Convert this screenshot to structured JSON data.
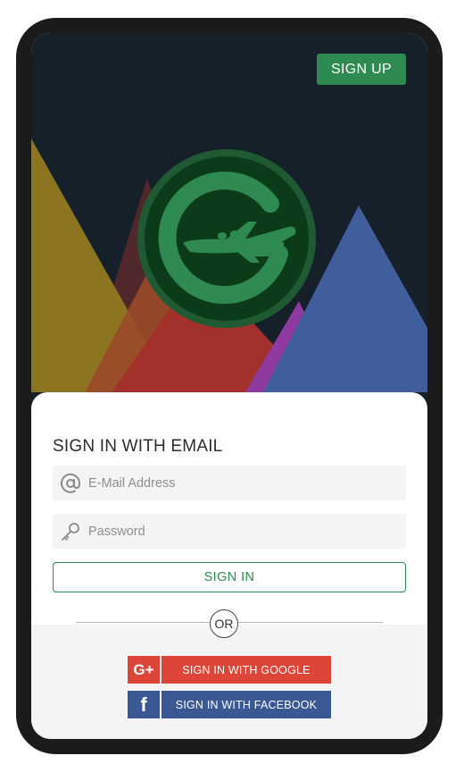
{
  "header": {
    "signup_label": "SIGN UP"
  },
  "login": {
    "title": "SIGN IN WITH EMAIL",
    "email_placeholder": "E-Mail Address",
    "password_placeholder": "Password",
    "signin_label": "SIGN IN",
    "or_label": "OR"
  },
  "social": {
    "google": {
      "icon_text": "G+",
      "label": "SIGN IN WITH GOOGLE"
    },
    "facebook": {
      "icon_text": "f",
      "label": "SIGN IN WITH FACEBOOK"
    }
  },
  "icons": {
    "email": "at-icon",
    "password": "key-icon",
    "logo": "airplane-logo-icon"
  },
  "colors": {
    "primary_green": "#2f8a52",
    "hero_bg": "#16202b",
    "google_red": "#dc4537",
    "facebook_blue": "#3a5894"
  }
}
